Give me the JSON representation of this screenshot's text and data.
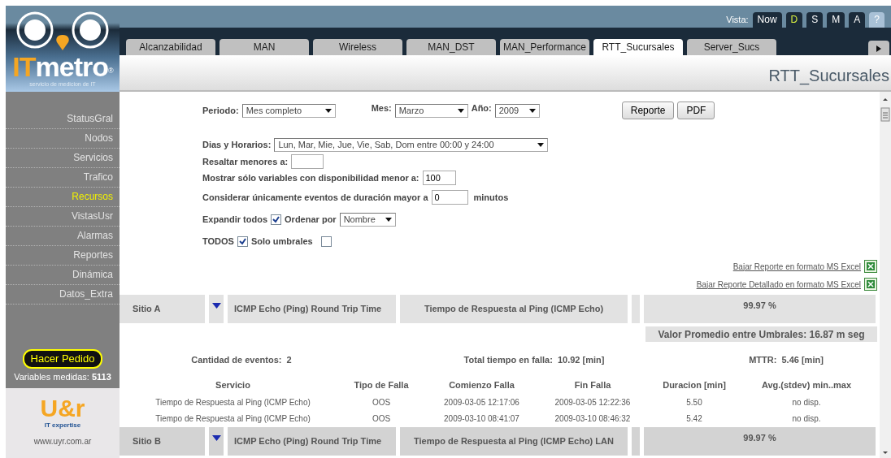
{
  "logo": {
    "prefix": "IT",
    "name": "metro",
    "mark": "®",
    "tagline": "servicio de medicion de IT"
  },
  "vista": {
    "label": "Vista:",
    "buttons": [
      {
        "label": "Now",
        "selected": false
      },
      {
        "label": "D",
        "selected": true
      },
      {
        "label": "S",
        "selected": false
      },
      {
        "label": "M",
        "selected": false
      },
      {
        "label": "A",
        "selected": false
      },
      {
        "label": "?",
        "selected": false
      }
    ]
  },
  "tabs": [
    {
      "label": "Alcanzabilidad",
      "selected": false
    },
    {
      "label": "MAN",
      "selected": false
    },
    {
      "label": "Wireless",
      "selected": false
    },
    {
      "label": "MAN_DST",
      "selected": false
    },
    {
      "label": "MAN_Performance",
      "selected": false
    },
    {
      "label": "RTT_Sucursales",
      "selected": true
    },
    {
      "label": "Server_Sucs",
      "selected": false
    }
  ],
  "page_title": "RTT_Sucursales",
  "sidebar": {
    "items": [
      {
        "label": "StatusGral",
        "selected": false
      },
      {
        "label": "Nodos",
        "selected": false
      },
      {
        "label": "Servicios",
        "selected": false
      },
      {
        "label": "Trafico",
        "selected": false
      },
      {
        "label": "Recursos",
        "selected": true
      },
      {
        "label": "VistasUsr",
        "selected": false
      },
      {
        "label": "Alarmas",
        "selected": false
      },
      {
        "label": "Reportes",
        "selected": false
      },
      {
        "label": "Dinámica",
        "selected": false
      },
      {
        "label": "Datos_Extra",
        "selected": false
      }
    ],
    "order_button": "Hacer Pedido",
    "variables_label": "Variables medidas:",
    "variables_count": "5113",
    "partner": {
      "logo": "U&r",
      "tagline": "IT expertise",
      "url": "www.uyr.com.ar"
    }
  },
  "form": {
    "periodo": {
      "label": "Periodo:",
      "value": "Mes completo"
    },
    "mes": {
      "label": "Mes:",
      "value": "Marzo"
    },
    "anio": {
      "label": "Año:",
      "value": "2009"
    },
    "buttons": [
      "Reporte",
      "PDF"
    ],
    "dias": {
      "label": "Dias y Horarios:",
      "value": "Lun, Mar, Mie, Jue, Vie, Sab, Dom entre 00:00 y 24:00"
    },
    "resaltar": {
      "label": "Resaltar menores a:"
    },
    "mostrar": {
      "label": "Mostrar sólo variables con disponibilidad menor a:",
      "value": "100"
    },
    "considerar": {
      "label": "Considerar únicamente eventos de duración mayor a",
      "value": "0",
      "unit": "minutos"
    },
    "expandir": {
      "label": "Expandir todos",
      "checked": true
    },
    "ordenar": {
      "label": "Ordenar por",
      "value": "Nombre"
    },
    "todos": {
      "label": "TODOS",
      "checked": true
    },
    "solo_umbrales": {
      "label": "Solo umbrales",
      "checked": false
    }
  },
  "downloads": [
    "Bajar Reporte en formato MS Excel",
    "Bajar Reporte Detallado en formato MS Excel"
  ],
  "sites": [
    {
      "name": "Sitio A",
      "type": "ICMP Echo (Ping) Round Trip Time",
      "service": "Tiempo de Respuesta al Ping (ICMP Echo)",
      "availability": "99.97 %",
      "average": "Valor Promedio entre Umbrales: 16.87 m seg",
      "summary": [
        "Cantidad de eventos:  2",
        "Total tiempo en falla:  10.92 [min]",
        "MTTR:  5.46 [min]"
      ],
      "columns": [
        "Servicio",
        "Tipo de Falla",
        "Comienzo Falla",
        "Fin Falla",
        "Duracion [min]",
        "Avg.(stdev) min..max"
      ],
      "rows": [
        [
          "Tiempo de Respuesta al Ping (ICMP Echo)",
          "OOS",
          "2009-03-05 12:17:06",
          "2009-03-05 12:22:36",
          "5.50",
          "no disp."
        ],
        [
          "Tiempo de Respuesta al Ping (ICMP Echo)",
          "OOS",
          "2009-03-10 08:41:07",
          "2009-03-10 08:46:32",
          "5.42",
          "no disp."
        ]
      ]
    },
    {
      "name": "Sitio B",
      "type": "ICMP Echo (Ping) Round Trip Time",
      "service": "Tiempo de Respuesta al Ping (ICMP Echo) LAN",
      "availability": "99.97 %"
    }
  ]
}
